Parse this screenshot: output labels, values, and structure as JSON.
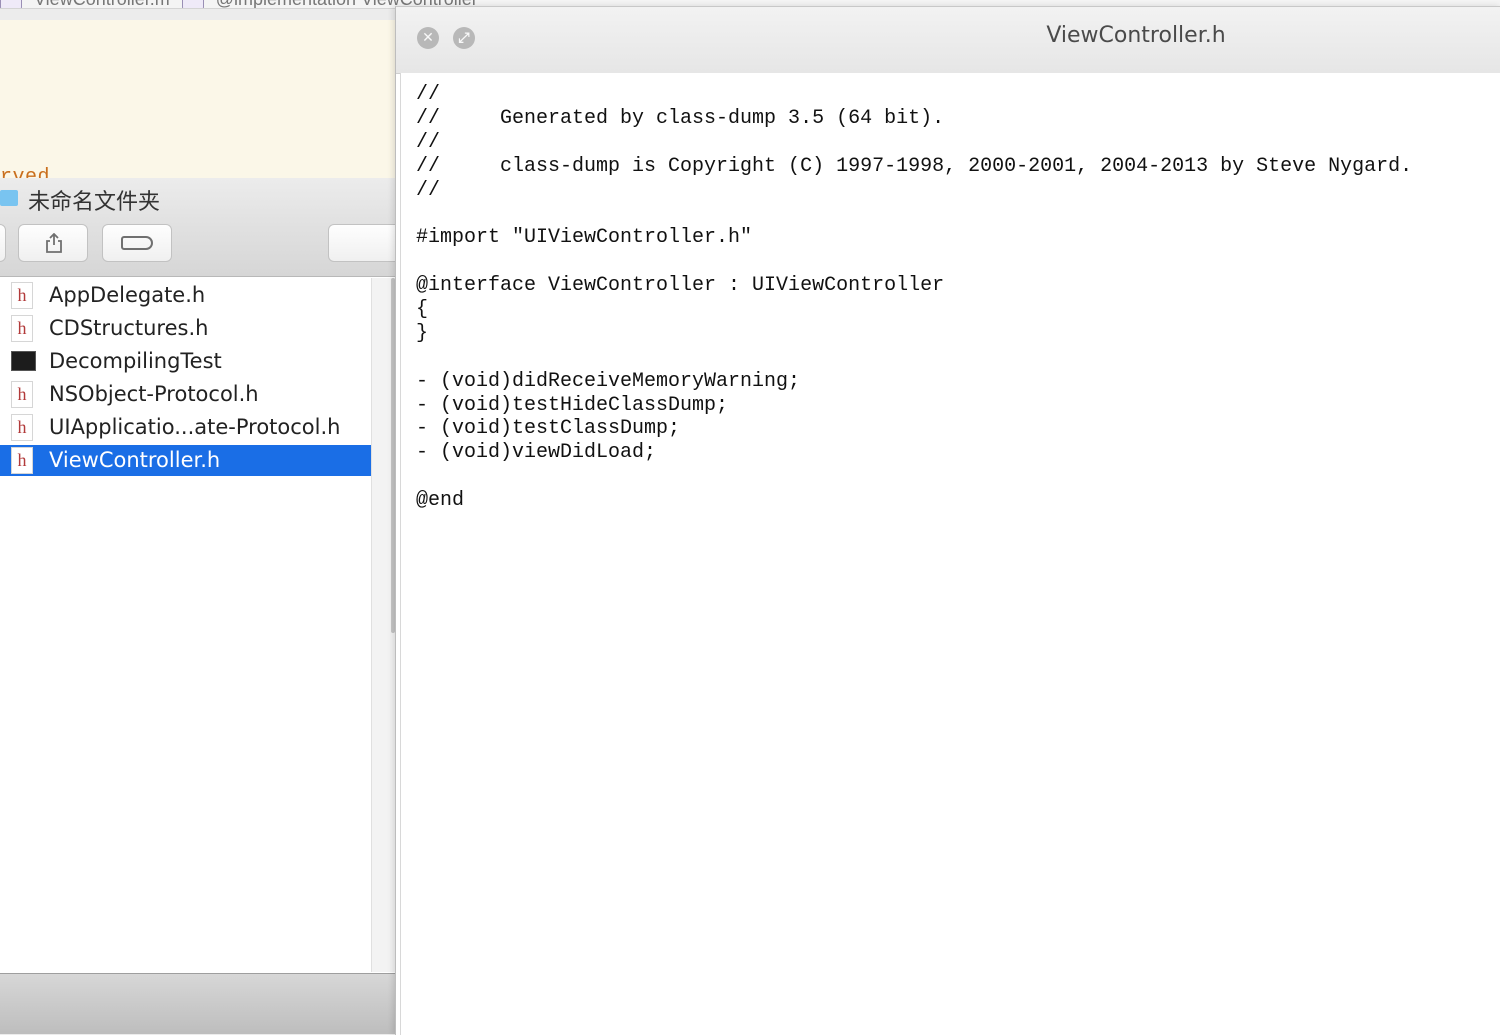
{
  "background_editor": {
    "breadcrumb_1": "ViewController.m",
    "breadcrumb_2": "@implementation ViewController",
    "visible_text_tail": "rved."
  },
  "finder": {
    "title": "未命名文件夹",
    "files": [
      {
        "name": "AppDelegate.h",
        "icon": "header-file-icon",
        "icon_glyph": "h",
        "selected": false
      },
      {
        "name": "CDStructures.h",
        "icon": "header-file-icon",
        "icon_glyph": "h",
        "selected": false
      },
      {
        "name": "DecompilingTest",
        "icon": "executable-icon",
        "icon_glyph": "exec",
        "selected": false
      },
      {
        "name": "NSObject-Protocol.h",
        "icon": "header-file-icon",
        "icon_glyph": "h",
        "selected": false
      },
      {
        "name": "UIApplicatio...ate-Protocol.h",
        "icon": "header-file-icon",
        "icon_glyph": "h",
        "selected": false
      },
      {
        "name": "ViewController.h",
        "icon": "header-file-icon",
        "icon_glyph": "h",
        "selected": true
      }
    ],
    "selection_color": "#1a6ee6"
  },
  "quicklook": {
    "title": "ViewController.h",
    "code_lines": [
      "//",
      "//     Generated by class-dump 3.5 (64 bit).",
      "//",
      "//     class-dump is Copyright (C) 1997-1998, 2000-2001, 2004-2013 by Steve Nygard.",
      "//",
      "",
      "#import \"UIViewController.h\"",
      "",
      "@interface ViewController : UIViewController",
      "{",
      "}",
      "",
      "- (void)didReceiveMemoryWarning;",
      "- (void)testHideClassDump;",
      "- (void)testClassDump;",
      "- (void)viewDidLoad;",
      "",
      "@end"
    ]
  }
}
